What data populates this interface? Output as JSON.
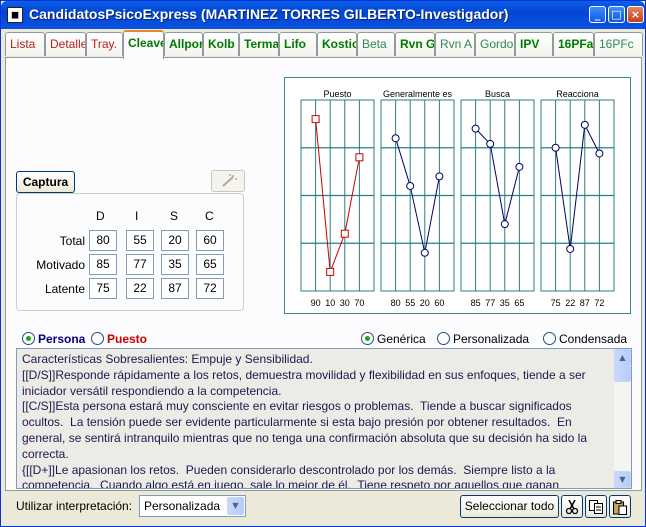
{
  "window": {
    "title": "CandidatosPsicoExpress (MARTINEZ TORRES GILBERTO-Investigador)",
    "controls": [
      "_",
      "□",
      "×"
    ]
  },
  "tabs": [
    {
      "label": "Lista",
      "style": "red"
    },
    {
      "label": "Detalle",
      "style": "red"
    },
    {
      "label": "Tray.",
      "style": "red"
    },
    {
      "label": "Cleaver",
      "style": "green",
      "active": true
    },
    {
      "label": "Allport",
      "style": "green"
    },
    {
      "label": "Kolb",
      "style": "green"
    },
    {
      "label": "Terman",
      "style": "green"
    },
    {
      "label": "Lifo",
      "style": "green"
    },
    {
      "label": "Kostick",
      "style": "green"
    },
    {
      "label": "Beta",
      "style": "lgreen"
    },
    {
      "label": "Rvn G",
      "style": "green"
    },
    {
      "label": "Rvn A",
      "style": "lgreen"
    },
    {
      "label": "Gordon",
      "style": "lgreen"
    },
    {
      "label": "IPV",
      "style": "green"
    },
    {
      "label": "16PFa",
      "style": "green"
    },
    {
      "label": "16PFc",
      "style": "lgreen"
    }
  ],
  "captura_button": "Captura",
  "scores": {
    "columns": [
      "D",
      "I",
      "S",
      "C"
    ],
    "rows": [
      {
        "label": "Total",
        "values": [
          "80",
          "55",
          "20",
          "60"
        ]
      },
      {
        "label": "Motivado",
        "values": [
          "85",
          "77",
          "35",
          "65"
        ]
      },
      {
        "label": "Latente",
        "values": [
          "75",
          "22",
          "87",
          "72"
        ]
      }
    ]
  },
  "chart_data": [
    {
      "type": "line",
      "title": "Puesto",
      "x": [
        "D",
        "I",
        "S",
        "C"
      ],
      "values": [
        90,
        10,
        30,
        70
      ],
      "tick_labels": [
        "90",
        "10",
        "30",
        "70"
      ],
      "color": "#cc0000",
      "marker": "square",
      "ylim": [
        0,
        100
      ],
      "grid": true
    },
    {
      "type": "line",
      "title": "Generalmente es",
      "x": [
        "D",
        "I",
        "S",
        "C"
      ],
      "values": [
        80,
        55,
        20,
        60
      ],
      "tick_labels": [
        "80",
        "55",
        "20",
        "60"
      ],
      "color": "#000066",
      "marker": "circle",
      "ylim": [
        0,
        100
      ],
      "grid": true
    },
    {
      "type": "line",
      "title": "Busca",
      "x": [
        "D",
        "I",
        "S",
        "C"
      ],
      "values": [
        85,
        77,
        35,
        65
      ],
      "tick_labels": [
        "85",
        "77",
        "35",
        "65"
      ],
      "color": "#000066",
      "marker": "circle",
      "ylim": [
        0,
        100
      ],
      "grid": true
    },
    {
      "type": "line",
      "title": "Reacciona",
      "x": [
        "D",
        "I",
        "S",
        "C"
      ],
      "values": [
        75,
        22,
        87,
        72
      ],
      "tick_labels": [
        "75",
        "22",
        "87",
        "72"
      ],
      "color": "#000066",
      "marker": "circle",
      "ylim": [
        0,
        100
      ],
      "grid": true
    }
  ],
  "view_radios": {
    "persona": "Persona",
    "puesto": "Puesto",
    "selected": "persona"
  },
  "mode_radios": {
    "generica": "Genérica",
    "personalizada": "Personalizada",
    "condensada": "Condensada",
    "selected": "generica"
  },
  "interpretation": {
    "text": "Características Sobresalientes: Empuje y Sensibilidad.\n[[D/S]]Responde rápidamente a los retos, demuestra movilidad y flexibilidad en sus enfoques, tiende a ser iniciador versátil respondiendo a la competencia.\n[[C/S]]Esta persona estará muy consciente en evitar riesgos o problemas.  Tiende a buscar significados ocultos.  La tensión puede ser evidente particularmente si esta bajo presión por obtener resultados.  En general, se sentirá intranquilo mientras que no tenga una confirmación absoluta que su decisión ha sido la correcta.\n{[[D+]]Le apasionan los retos.  Pueden considerarlo descontrolado por los demás.  Siempre listo a la competencia.  Cuando algo está en juego, sale lo mejor de él.  Tiene respeto por aquellos que ganan"
  },
  "footer": {
    "interp_label": "Utilizar interpretación:",
    "interp_value": "Personalizada",
    "select_all": "Seleccionar todo"
  },
  "colors": {
    "accent_orange": "#e68b2c",
    "puesto_red": "#cc0000",
    "line_navy": "#000066",
    "grid_teal": "#2a7f7f"
  }
}
